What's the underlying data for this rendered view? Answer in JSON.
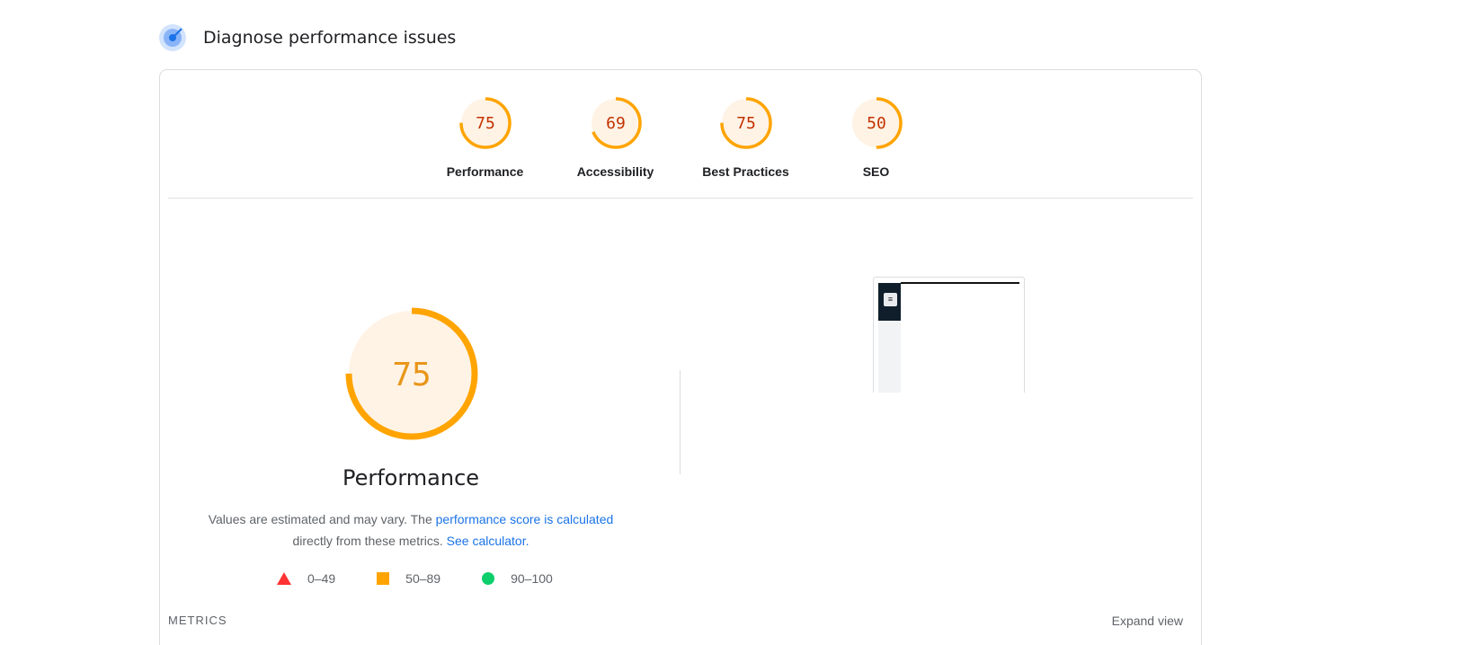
{
  "header": {
    "title": "Diagnose performance issues",
    "icon": "lighthouse-icon"
  },
  "categories": [
    {
      "label": "Performance",
      "score": 75,
      "value": "75"
    },
    {
      "label": "Accessibility",
      "score": 69,
      "value": "69"
    },
    {
      "label": "Best Practices",
      "score": 75,
      "value": "75"
    },
    {
      "label": "SEO",
      "score": 50,
      "value": "50"
    }
  ],
  "performance": {
    "score": 75,
    "score_text": "75",
    "title": "Performance",
    "desc_prefix": "Values are estimated and may vary. The",
    "link_calc": "performance score is calculated",
    "desc_mid": "directly from these metrics.",
    "link_calculator": "See calculator."
  },
  "legend": [
    {
      "label": "0–49",
      "shape": "triangle",
      "color": "#ff3333"
    },
    {
      "label": "50–89",
      "shape": "square",
      "color": "#ffa400"
    },
    {
      "label": "90–100",
      "shape": "circle",
      "color": "#0cce6b"
    }
  ],
  "metrics": {
    "label": "METRICS",
    "expand_label": "Expand view"
  },
  "colors": {
    "average": "#ffa400",
    "average_bg": "#fff3e6",
    "score_text": "#c33300",
    "link": "#1a73e8"
  }
}
